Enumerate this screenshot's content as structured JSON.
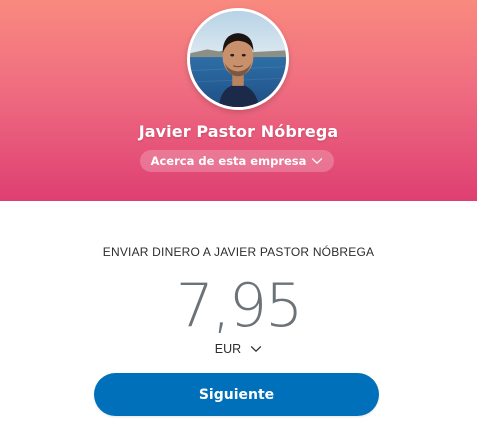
{
  "profile": {
    "name": "Javier Pastor Nóbrega",
    "about_label": "Acerca de esta empresa"
  },
  "payment": {
    "send_label": "ENVIAR DINERO A JAVIER PASTOR NÓBREGA",
    "amount": "7,95",
    "currency": "EUR",
    "next_label": "Siguiente"
  },
  "colors": {
    "header_top": "#f98a7f",
    "header_bottom": "#de3f72",
    "button": "#0070ba",
    "amount_text": "#6c7378"
  },
  "icons": {
    "about_chevron": "chevron-down-icon",
    "currency_chevron": "chevron-down-icon"
  }
}
